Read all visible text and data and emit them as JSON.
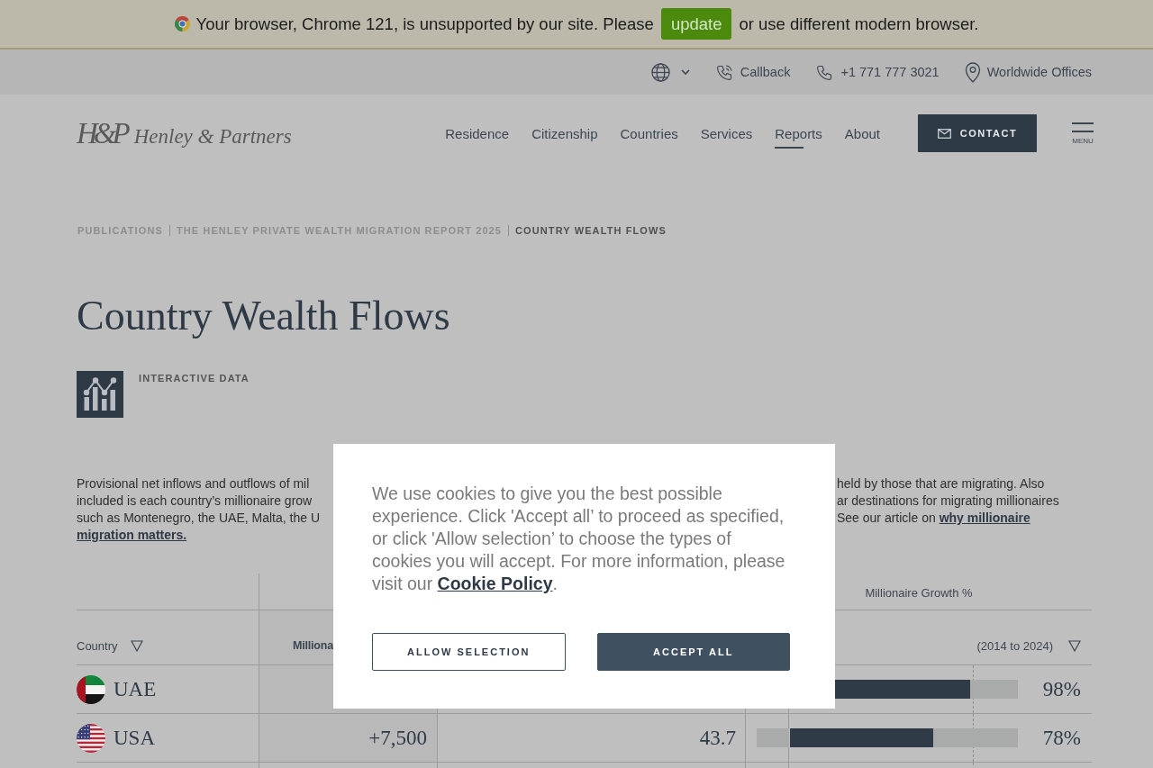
{
  "browser_notice": {
    "before": "Your browser, Chrome 121, is unsupported by our site. Please",
    "button": "update",
    "after": "or use different modern browser."
  },
  "utility_bar": {
    "items": [
      {
        "kind": "language"
      },
      {
        "kind": "callback",
        "label": "Callback"
      },
      {
        "kind": "phone",
        "label": "+1 771 777 3021"
      },
      {
        "kind": "offices",
        "label": "Worldwide Offices"
      }
    ]
  },
  "header": {
    "logo": {
      "monogram": "H&P",
      "name": "Henley & Partners"
    },
    "nav": [
      {
        "label": "Residence",
        "selected": false
      },
      {
        "label": "Citizenship",
        "selected": false
      },
      {
        "label": "Countries",
        "selected": false
      },
      {
        "label": "Services",
        "selected": false
      },
      {
        "label": "Reports",
        "selected": true
      },
      {
        "label": "About",
        "selected": false
      }
    ],
    "contact_button": "CONTACT",
    "menu_button": "MENU"
  },
  "breadcrumb": [
    {
      "label": "PUBLICATIONS",
      "current": false
    },
    {
      "label": "THE HENLEY PRIVATE WEALTH MIGRATION REPORT 2025",
      "current": false
    },
    {
      "label": "COUNTRY WEALTH FLOWS",
      "current": true
    }
  ],
  "page_title": "Country Wealth Flows",
  "tag": {
    "label": "INTERACTIVE DATA"
  },
  "intro": {
    "left_lines": [
      "Provisional net inflows and outflows of mil",
      "included is each country’s millionaire grow",
      "such as Montenegro, the UAE, Malta, the U"
    ],
    "left_link": "migration matters.",
    "right_lines": [
      "held by those that are migrating. Also",
      "ar destinations for migrating millionaires",
      "See our article on "
    ],
    "right_link": "why millionaire"
  },
  "table": {
    "group_heading": "Millionaire Growth %",
    "columns": [
      {
        "label": "Country",
        "sortable": true
      },
      {
        "label": "Milliona",
        "sortable": false
      },
      {
        "label": "(2014 to 2024)",
        "sortable": true
      }
    ],
    "rows": [
      {
        "country": "UAE",
        "kind": "uae",
        "growth": "98%",
        "level": 0.79
      },
      {
        "country": "USA",
        "kind": "usa",
        "column_2": "+7,500",
        "column_3": "43.7",
        "growth": "78%",
        "level": 0.63
      }
    ]
  },
  "cookie_dialog": {
    "text": "We use cookies to give you the best possible experience. Click 'Accept all’ to proceed as specified, or click 'Allow selection’ to choose the types of cookies you will accept. For more information, please visit our ",
    "link": "Cookie Policy",
    "after": ".",
    "buttons": [
      {
        "label": "ALLOW SELECTION",
        "kind": "secondary"
      },
      {
        "label": "ACCEPT ALL",
        "kind": "primary"
      }
    ]
  }
}
